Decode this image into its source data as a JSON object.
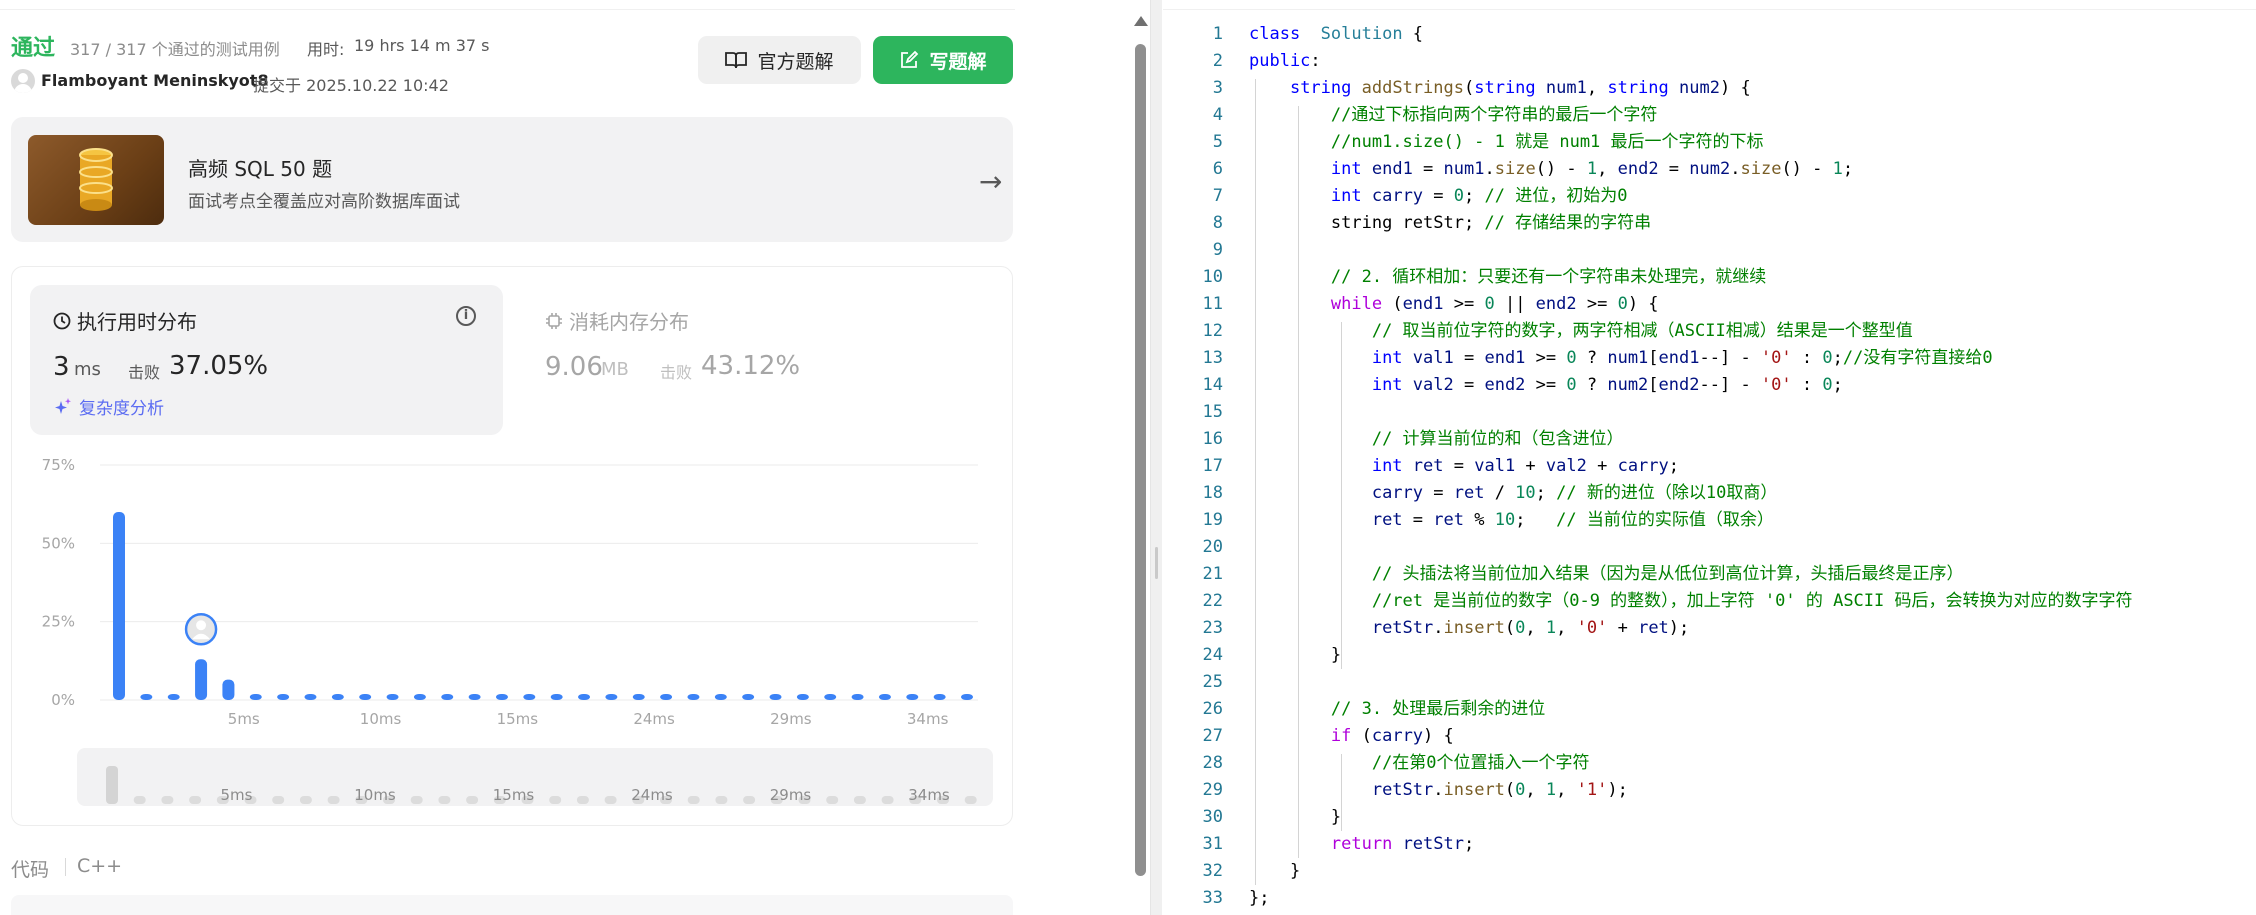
{
  "submission": {
    "status": "通过",
    "cases": "317 / 317 个通过的测试用例",
    "elapsed_label": "用时:",
    "elapsed": "19 hrs 14 m 37 s",
    "username": "Flamboyant Meninskyot8",
    "submitted": "提交于 2025.10.22 10:42",
    "official_button": "官方题解",
    "write_button": "写题解"
  },
  "banner": {
    "title": "高频 SQL 50 题",
    "subtitle": "面试考点全覆盖应对高阶数据库面试"
  },
  "runtime": {
    "title": "执行用时分布",
    "value": "3",
    "unit": "ms",
    "beat_label": "击败",
    "beat": "37.05%",
    "complexity": "复杂度分析"
  },
  "memory": {
    "title": "消耗内存分布",
    "value": "9.06",
    "unit": "MB",
    "beat_label": "击败",
    "beat": "43.12%"
  },
  "chart_data": {
    "type": "bar",
    "title": "",
    "xlabel": "",
    "ylabel": "",
    "yticks": [
      "0%",
      "25%",
      "50%",
      "75%"
    ],
    "ylim": [
      0,
      75
    ],
    "grid": true,
    "x_tick_labels": [
      "5ms",
      "10ms",
      "15ms",
      "24ms",
      "29ms",
      "34ms"
    ],
    "values": [
      60,
      1,
      1,
      13,
      6.5,
      1,
      1,
      1,
      1,
      1,
      1,
      1,
      1,
      1,
      1,
      1,
      1,
      1,
      1,
      1,
      1,
      1,
      1,
      1,
      1,
      1,
      1,
      1,
      1,
      1,
      1,
      1
    ],
    "highlight_index": 3,
    "color": "#3b82f6"
  },
  "mini_chart": {
    "x_tick_labels": [
      "5ms",
      "10ms",
      "15ms",
      "24ms",
      "29ms",
      "34ms"
    ]
  },
  "code_section": {
    "label": "代码",
    "language": "C++"
  },
  "editor": {
    "lines": [
      [
        [
          "kw",
          "class"
        ],
        [
          "",
          "  "
        ],
        [
          "cls",
          "Solution"
        ],
        [
          "",
          " {"
        ]
      ],
      [
        [
          "kw",
          "public"
        ],
        [
          "",
          ":"
        ]
      ],
      [
        [
          "",
          "    "
        ],
        [
          "kw",
          "string"
        ],
        [
          "",
          " "
        ],
        [
          "fn",
          "addStrings"
        ],
        [
          "",
          "("
        ],
        [
          "kw",
          "string"
        ],
        [
          "",
          " "
        ],
        [
          "var",
          "num1"
        ],
        [
          "",
          ", "
        ],
        [
          "kw",
          "string"
        ],
        [
          "",
          " "
        ],
        [
          "var",
          "num2"
        ],
        [
          "",
          ") {"
        ]
      ],
      [
        [
          "",
          "        "
        ],
        [
          "cm",
          "//通过下标指向两个字符串的最后一个字符"
        ]
      ],
      [
        [
          "",
          "        "
        ],
        [
          "cm",
          "//num1.size() - 1 就是 num1 最后一个字符的下标"
        ]
      ],
      [
        [
          "",
          "        "
        ],
        [
          "kw",
          "int"
        ],
        [
          "",
          " "
        ],
        [
          "var",
          "end1"
        ],
        [
          "",
          " = "
        ],
        [
          "var",
          "num1"
        ],
        [
          "",
          "."
        ],
        [
          "fn",
          "size"
        ],
        [
          "",
          "() - "
        ],
        [
          "num",
          "1"
        ],
        [
          "",
          ", "
        ],
        [
          "var",
          "end2"
        ],
        [
          "",
          " = "
        ],
        [
          "var",
          "num2"
        ],
        [
          "",
          "."
        ],
        [
          "fn",
          "size"
        ],
        [
          "",
          "() - "
        ],
        [
          "num",
          "1"
        ],
        [
          "",
          ";"
        ]
      ],
      [
        [
          "",
          "        "
        ],
        [
          "kw",
          "int"
        ],
        [
          "",
          " "
        ],
        [
          "var",
          "carry"
        ],
        [
          "",
          " = "
        ],
        [
          "num",
          "0"
        ],
        [
          "",
          "; "
        ],
        [
          "cm",
          "// 进位，初始为0"
        ]
      ],
      [
        [
          "",
          "        "
        ],
        [
          "",
          "string retStr; "
        ],
        [
          "cm",
          "// 存储结果的字符串"
        ]
      ],
      [
        [
          "",
          ""
        ]
      ],
      [
        [
          "",
          "        "
        ],
        [
          "cm",
          "// 2. 循环相加：只要还有一个字符串未处理完，就继续"
        ]
      ],
      [
        [
          "",
          "        "
        ],
        [
          "ctl",
          "while"
        ],
        [
          "",
          " ("
        ],
        [
          "var",
          "end1"
        ],
        [
          "",
          " >= "
        ],
        [
          "num",
          "0"
        ],
        [
          "",
          " || "
        ],
        [
          "var",
          "end2"
        ],
        [
          "",
          " >= "
        ],
        [
          "num",
          "0"
        ],
        [
          "",
          ") {"
        ]
      ],
      [
        [
          "",
          "            "
        ],
        [
          "cm",
          "// 取当前位字符的数字，两字符相减（ASCII相减）结果是一个整型值"
        ]
      ],
      [
        [
          "",
          "            "
        ],
        [
          "kw",
          "int"
        ],
        [
          "",
          " "
        ],
        [
          "var",
          "val1"
        ],
        [
          "",
          " = "
        ],
        [
          "var",
          "end1"
        ],
        [
          "",
          " >= "
        ],
        [
          "num",
          "0"
        ],
        [
          "",
          " ? "
        ],
        [
          "var",
          "num1"
        ],
        [
          "",
          "["
        ],
        [
          "var",
          "end1"
        ],
        [
          "",
          "--] - "
        ],
        [
          "str",
          "'0'"
        ],
        [
          "",
          " : "
        ],
        [
          "num",
          "0"
        ],
        [
          "",
          ";"
        ],
        [
          "cm",
          "//没有字符直接给0"
        ]
      ],
      [
        [
          "",
          "            "
        ],
        [
          "kw",
          "int"
        ],
        [
          "",
          " "
        ],
        [
          "var",
          "val2"
        ],
        [
          "",
          " = "
        ],
        [
          "var",
          "end2"
        ],
        [
          "",
          " >= "
        ],
        [
          "num",
          "0"
        ],
        [
          "",
          " ? "
        ],
        [
          "var",
          "num2"
        ],
        [
          "",
          "["
        ],
        [
          "var",
          "end2"
        ],
        [
          "",
          "--] - "
        ],
        [
          "str",
          "'0'"
        ],
        [
          "",
          " : "
        ],
        [
          "num",
          "0"
        ],
        [
          "",
          ";"
        ]
      ],
      [
        [
          "",
          ""
        ]
      ],
      [
        [
          "",
          "            "
        ],
        [
          "cm",
          "// 计算当前位的和（包含进位）"
        ]
      ],
      [
        [
          "",
          "            "
        ],
        [
          "kw",
          "int"
        ],
        [
          "",
          " "
        ],
        [
          "var",
          "ret"
        ],
        [
          "",
          " = "
        ],
        [
          "var",
          "val1"
        ],
        [
          "",
          " + "
        ],
        [
          "var",
          "val2"
        ],
        [
          "",
          " + "
        ],
        [
          "var",
          "carry"
        ],
        [
          "",
          ";"
        ]
      ],
      [
        [
          "",
          "            "
        ],
        [
          "var",
          "carry"
        ],
        [
          "",
          " = "
        ],
        [
          "var",
          "ret"
        ],
        [
          "",
          " / "
        ],
        [
          "num",
          "10"
        ],
        [
          "",
          "; "
        ],
        [
          "cm",
          "// 新的进位（除以10取商）"
        ]
      ],
      [
        [
          "",
          "            "
        ],
        [
          "var",
          "ret"
        ],
        [
          "",
          " = "
        ],
        [
          "var",
          "ret"
        ],
        [
          "",
          " % "
        ],
        [
          "num",
          "10"
        ],
        [
          "",
          ";   "
        ],
        [
          "cm",
          "// 当前位的实际值（取余）"
        ]
      ],
      [
        [
          "",
          ""
        ]
      ],
      [
        [
          "",
          "            "
        ],
        [
          "cm",
          "// 头插法将当前位加入结果（因为是从低位到高位计算，头插后最终是正序）"
        ]
      ],
      [
        [
          "",
          "            "
        ],
        [
          "cm",
          "//ret 是当前位的数字（0-9 的整数），加上字符 '0' 的 ASCII 码后，会转换为对应的数字字符"
        ]
      ],
      [
        [
          "",
          "            "
        ],
        [
          "var",
          "retStr"
        ],
        [
          "",
          "."
        ],
        [
          "fn",
          "insert"
        ],
        [
          "",
          "("
        ],
        [
          "num",
          "0"
        ],
        [
          "",
          ", "
        ],
        [
          "num",
          "1"
        ],
        [
          "",
          ", "
        ],
        [
          "str",
          "'0'"
        ],
        [
          "",
          " + "
        ],
        [
          "var",
          "ret"
        ],
        [
          "",
          ");"
        ]
      ],
      [
        [
          "",
          "        "
        ],
        [
          "",
          "}"
        ]
      ],
      [
        [
          "",
          ""
        ]
      ],
      [
        [
          "",
          "        "
        ],
        [
          "cm",
          "// 3. 处理最后剩余的进位"
        ]
      ],
      [
        [
          "",
          "        "
        ],
        [
          "ctl",
          "if"
        ],
        [
          "",
          " ("
        ],
        [
          "var",
          "carry"
        ],
        [
          "",
          ") {"
        ]
      ],
      [
        [
          "",
          "            "
        ],
        [
          "cm",
          "//在第0个位置插入一个字符"
        ]
      ],
      [
        [
          "",
          "            "
        ],
        [
          "var",
          "retStr"
        ],
        [
          "",
          "."
        ],
        [
          "fn",
          "insert"
        ],
        [
          "",
          "("
        ],
        [
          "num",
          "0"
        ],
        [
          "",
          ", "
        ],
        [
          "num",
          "1"
        ],
        [
          "",
          ", "
        ],
        [
          "str",
          "'1'"
        ],
        [
          "",
          ");"
        ]
      ],
      [
        [
          "",
          "        "
        ],
        [
          "",
          "}"
        ]
      ],
      [
        [
          "",
          "        "
        ],
        [
          "ctl",
          "return"
        ],
        [
          "",
          " "
        ],
        [
          "var",
          "retStr"
        ],
        [
          "",
          ";"
        ]
      ],
      [
        [
          "",
          "    "
        ],
        [
          "",
          "}"
        ]
      ],
      [
        [
          "",
          "};"
        ]
      ]
    ]
  }
}
